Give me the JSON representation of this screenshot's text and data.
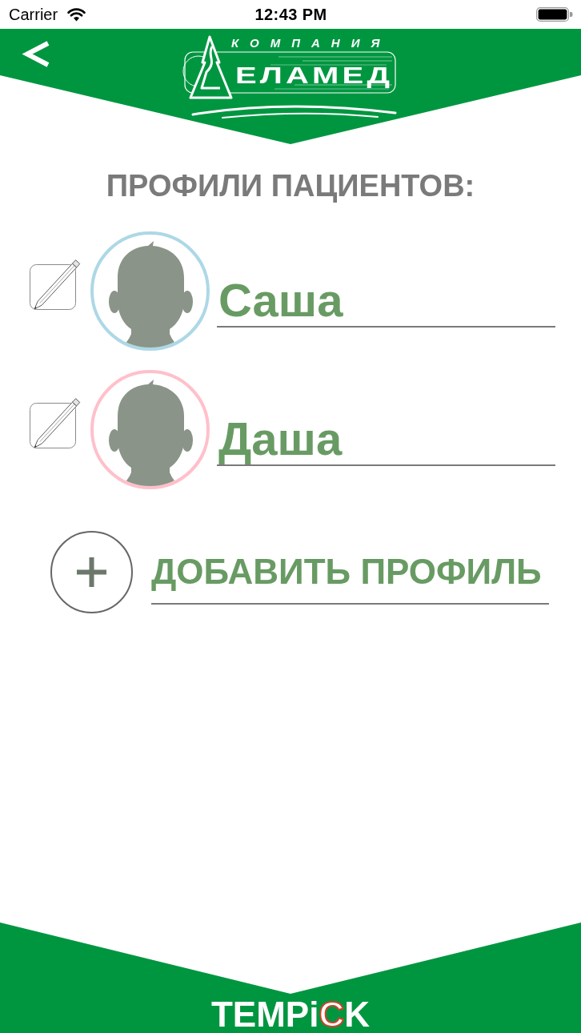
{
  "status_bar": {
    "carrier": "Carrier",
    "time": "12:43 PM"
  },
  "header": {
    "logo_caption": "КОМПАНИЯ",
    "logo_name": "ЕЛАМЕД"
  },
  "title": "ПРОФИЛИ ПАЦИЕНТОВ:",
  "profiles": [
    {
      "name": "Саша",
      "color": "#add8e6"
    },
    {
      "name": "Даша",
      "color": "#ffc0cb"
    }
  ],
  "add_profile": {
    "label": "ДОБАВИТЬ ПРОФИЛЬ"
  },
  "footer": {
    "brand": [
      {
        "text": "TEMPi",
        "kind": "plain"
      },
      {
        "text": "C",
        "kind": "accent"
      },
      {
        "text": "K",
        "kind": "plain"
      }
    ]
  }
}
